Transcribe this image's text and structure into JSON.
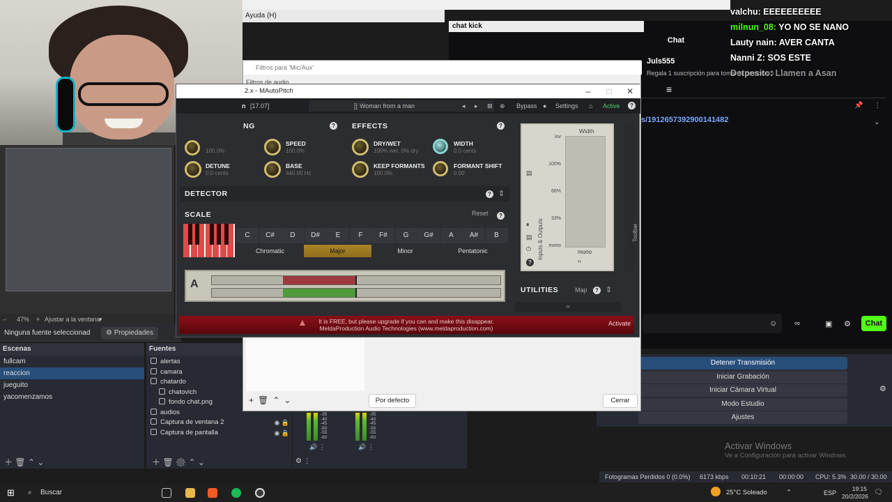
{
  "menu": {
    "help": "Ayuda (H)"
  },
  "chat": {
    "header": "chat kick",
    "title": "Chat",
    "user_line": "Juls555",
    "gift_line": "Regala 1 suscripción para tomar la posición 3",
    "url": "s/1912657392900141482",
    "send": "Chat"
  },
  "overlay_chat": [
    {
      "user": "valchu:",
      "msg": "EEEEEEEEEE",
      "color": "#ffffff"
    },
    {
      "user": "milnun_08:",
      "msg": "YO NO SE NANO",
      "color": "#53fc18"
    },
    {
      "user": "Lauty nain:",
      "msg": "AVER CANTA",
      "color": "#ffffff"
    },
    {
      "user": "Nanni Z:",
      "msg": "SOS ESTE",
      "color": "#ffffff"
    },
    {
      "user": "Detpesito:",
      "msg": "Llamen a Asan",
      "color": "#ffffff"
    }
  ],
  "obs": {
    "zoom": "47%",
    "fit": "Ajustar a la ventana",
    "no_source": "Ninguna fuente seleccionad",
    "properties": "Propiedades",
    "scenes_title": "Escenas",
    "scenes": [
      "fullcam",
      "reaccion",
      "jueguito",
      "yacomenzamos"
    ],
    "selected_scene": 1,
    "sources_title": "Fuentes",
    "sources": [
      {
        "name": "alertas",
        "indent": 0
      },
      {
        "name": "camara",
        "indent": 0
      },
      {
        "name": "chatardo",
        "indent": 0
      },
      {
        "name": "chatovich",
        "indent": 1
      },
      {
        "name": "fondo chat.png",
        "indent": 1
      },
      {
        "name": "audios",
        "indent": 0
      },
      {
        "name": "Captura de ventana 2",
        "indent": 0
      },
      {
        "name": "Captura de pantalla",
        "indent": 0
      }
    ],
    "controls": [
      "Detener Transmisión",
      "Iniciar Grabación",
      "Iniciar Cámara Virtual",
      "Modo Estudio",
      "Ajustes"
    ],
    "meter_labels": [
      "-35",
      "-40",
      "-45",
      "-50",
      "-55",
      "-60"
    ],
    "status": {
      "dropped": "Fotogramas Perdidos 0 (0.0%)",
      "kbps": "6173 kbps",
      "time": "00:10:21",
      "rec": "00:00:00",
      "cpu": "CPU: 5.3%",
      "fps": "30.00 / 30.00 FPS"
    },
    "activate_title": "Activar Windows",
    "activate_sub": "Ve a Configuración para activar Windows"
  },
  "filter_dialog": {
    "title": "Filtros para 'Mic/Aux'",
    "list_header": "Filtros de audio",
    "default_btn": "Por defecto",
    "close_btn": "Cerrar"
  },
  "plugin": {
    "title": "2.x - MAutoPitch",
    "version": "[17.07]",
    "preset": "Woman from a man",
    "bypass": "Bypass",
    "settings": "Settings",
    "active": "Active",
    "tuning_header": "NG",
    "effects_header": "EFFECTS",
    "knobs": {
      "speed": {
        "label": "SPEED",
        "val": "100.0%"
      },
      "detune": {
        "label": "DETUNE",
        "val": "0.0 cents"
      },
      "base": {
        "label": "BASE",
        "val": "440.00 Hz"
      },
      "drywet": {
        "label": "DRY/WET",
        "val": "100% wet, 0% dry"
      },
      "keepformants": {
        "label": "KEEP FORMANTS",
        "val": "100.0%"
      },
      "width": {
        "label": "WIDTH",
        "val": "0.0 cents"
      },
      "formantshift": {
        "label": "FORMANT SHIFT",
        "val": "0.00"
      },
      "topval": {
        "val": "100.0%"
      }
    },
    "detector": "DETECTOR",
    "scale": "SCALE",
    "reset": "Reset",
    "notes": [
      "C",
      "C#",
      "D",
      "D#",
      "E",
      "F",
      "F#",
      "G",
      "G#",
      "A",
      "A#",
      "B"
    ],
    "modes": [
      "Chromatic",
      "Major",
      "Minor",
      "Pentatonic"
    ],
    "active_mode": 1,
    "tuner_note": "A",
    "io": {
      "title": "Width",
      "ticks": [
        "inv",
        "100%",
        "66%",
        "33%",
        "mono"
      ],
      "bottom": "mono",
      "side": "Inputs & Outputs",
      "toolbar": "Toolbar"
    },
    "utilities": "UTILITIES",
    "map": "Map",
    "footer_line1": "It is FREE, but please upgrade if you can and make this disappear.",
    "footer_line2": "MeldaProduction Audio Technologies (www.meldaproduction.com)",
    "activate": "Activate"
  },
  "taskbar": {
    "search": "Buscar",
    "weather": "25°C Soleado",
    "lang": "ESP",
    "time": "19:15",
    "date": "20/2/2026"
  }
}
